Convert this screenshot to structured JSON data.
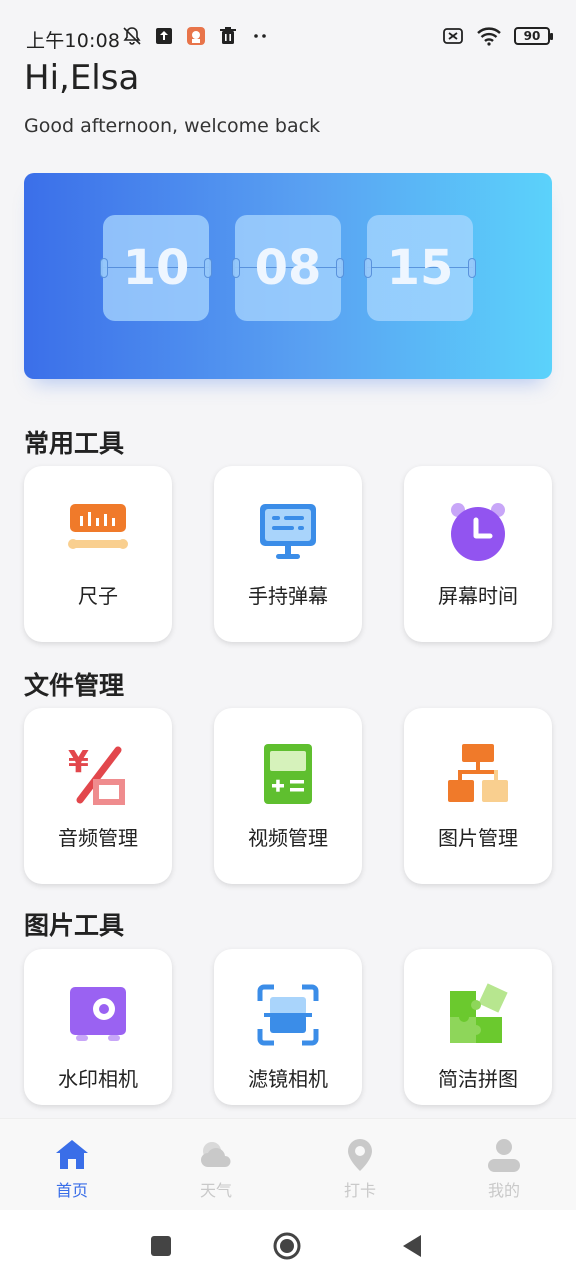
{
  "status_bar": {
    "time": "上午10:08",
    "battery": "90"
  },
  "header": {
    "greeting": "Hi,Elsa",
    "subtitle": "Good afternoon, welcome back"
  },
  "clock": {
    "hours": "10",
    "minutes": "08",
    "seconds": "15"
  },
  "sections": [
    {
      "title": "常用工具",
      "items": [
        {
          "label": "尺子",
          "icon": "ruler-icon"
        },
        {
          "label": "手持弹幕",
          "icon": "screen-icon"
        },
        {
          "label": "屏幕时间",
          "icon": "alarm-clock-icon"
        }
      ]
    },
    {
      "title": "文件管理",
      "items": [
        {
          "label": "音频管理",
          "icon": "yuan-tag-icon"
        },
        {
          "label": "视频管理",
          "icon": "calculator-icon"
        },
        {
          "label": "图片管理",
          "icon": "org-chart-icon"
        }
      ]
    },
    {
      "title": "图片工具",
      "items": [
        {
          "label": "水印相机",
          "icon": "safe-icon"
        },
        {
          "label": "滤镜相机",
          "icon": "scan-icon"
        },
        {
          "label": "简洁拼图",
          "icon": "puzzle-icon"
        }
      ]
    }
  ],
  "bottom_nav": [
    {
      "label": "首页",
      "icon": "home-icon",
      "active": true
    },
    {
      "label": "天气",
      "icon": "weather-icon",
      "active": false
    },
    {
      "label": "打卡",
      "icon": "location-pin-icon",
      "active": false
    },
    {
      "label": "我的",
      "icon": "user-icon",
      "active": false
    }
  ],
  "colors": {
    "accent": "#3a6ee8",
    "inactive": "#c9c9c9",
    "gradient_start": "#3b6fe9",
    "gradient_end": "#5bd2fb"
  }
}
